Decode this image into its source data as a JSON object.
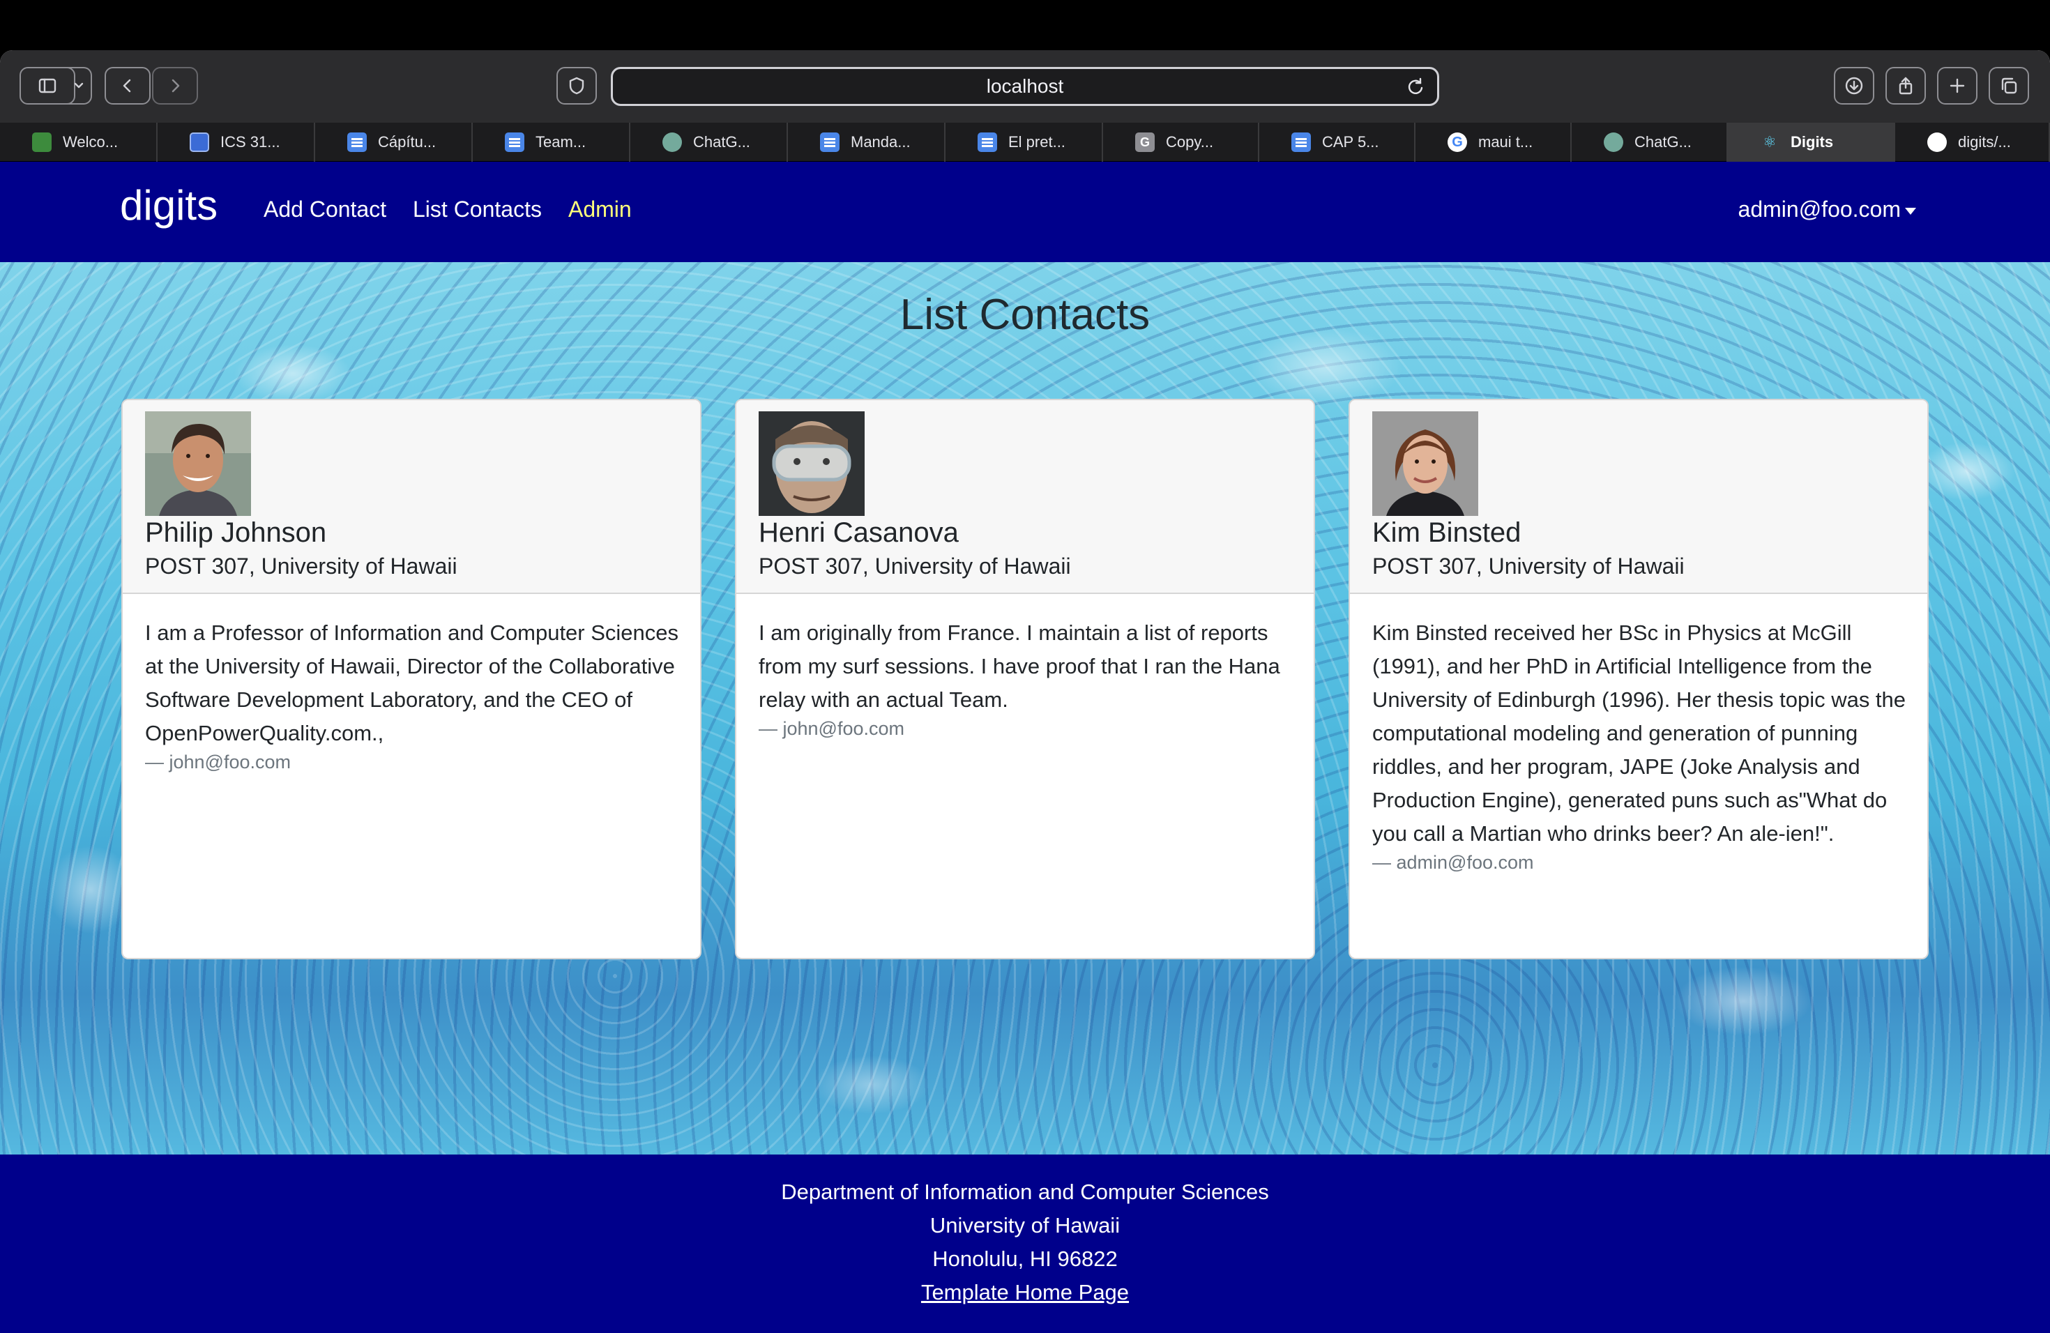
{
  "browser": {
    "url": "localhost",
    "tabs": [
      {
        "label": "Welco...",
        "icon": "leaf-icon",
        "fav": "green"
      },
      {
        "label": "ICS 31...",
        "icon": "square-icon",
        "fav": "blue-sq"
      },
      {
        "label": "Cápítu...",
        "icon": "doc-icon",
        "fav": "doc"
      },
      {
        "label": "Team...",
        "icon": "doc-icon",
        "fav": "doc"
      },
      {
        "label": "ChatG...",
        "icon": "chatgpt-icon",
        "fav": "gpt"
      },
      {
        "label": "Manda...",
        "icon": "doc-icon",
        "fav": "doc"
      },
      {
        "label": "El pret...",
        "icon": "doc-icon",
        "fav": "doc"
      },
      {
        "label": "Copy...",
        "icon": "g-icon",
        "fav": "gray"
      },
      {
        "label": "CAP 5...",
        "icon": "doc-icon",
        "fav": "doc"
      },
      {
        "label": "maui t...",
        "icon": "google-icon",
        "fav": "goog"
      },
      {
        "label": "ChatG...",
        "icon": "chatgpt-icon",
        "fav": "gpt"
      },
      {
        "label": "Digits",
        "icon": "react-icon",
        "fav": "react",
        "active": true
      },
      {
        "label": "digits/...",
        "icon": "github-icon",
        "fav": "gh"
      }
    ]
  },
  "nav": {
    "brand": "digits",
    "links": [
      "Add Contact",
      "List Contacts",
      "Admin"
    ],
    "user": "admin@foo.com"
  },
  "main": {
    "title": "List Contacts",
    "contacts": [
      {
        "name": "Philip Johnson",
        "address": "POST 307, University of Hawaii",
        "description": "I am a Professor of Information and Computer Sciences at the University of Hawaii, Director of the Collaborative Software Development Laboratory, and the CEO of OpenPowerQuality.com.,",
        "owner": "— john@foo.com"
      },
      {
        "name": "Henri Casanova",
        "address": "POST 307, University of Hawaii",
        "description": "I am originally from France. I maintain a list of reports from my surf sessions. I have proof that I ran the Hana relay with an actual Team.",
        "owner": "— john@foo.com"
      },
      {
        "name": "Kim Binsted",
        "address": "POST 307, University of Hawaii",
        "description": "Kim Binsted received her BSc in Physics at McGill (1991), and her PhD in Artificial Intelligence from the University of Edinburgh (1996). Her thesis topic was the computational modeling and generation of punning riddles, and her program, JAPE (Joke Analysis and Production Engine), generated puns such as\"What do you call a Martian who drinks beer? An ale-ien!\".",
        "owner": "— admin@foo.com"
      }
    ]
  },
  "footer": {
    "line1": "Department of Information and Computer Sciences",
    "line2": "University of Hawaii",
    "line3": "Honolulu, HI 96822",
    "link": "Template Home Page"
  },
  "colors": {
    "navbar": "#00008b",
    "active_link": "#ffff7a"
  }
}
